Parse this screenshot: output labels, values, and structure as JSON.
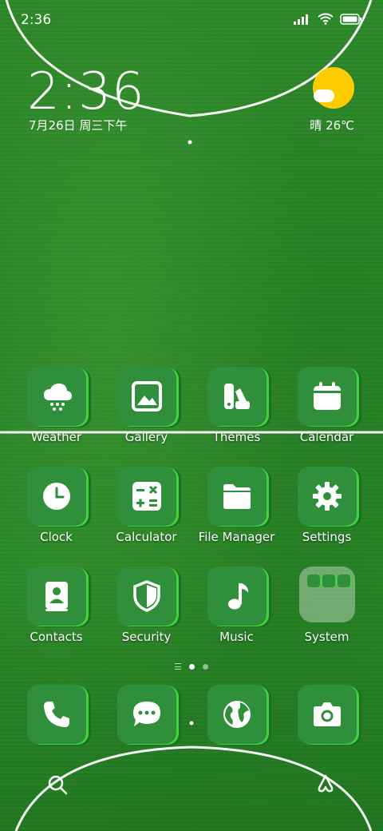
{
  "status_bar": {
    "time": "2:36"
  },
  "lock_clock": {
    "time": "2:36",
    "date": "7月26日 周三下午"
  },
  "weather": {
    "text": "晴 26℃",
    "icon": "sunny-cloud-icon"
  },
  "apps": [
    {
      "label": "Weather",
      "icon": "cloud-snow-icon"
    },
    {
      "label": "Gallery",
      "icon": "image-icon"
    },
    {
      "label": "Themes",
      "icon": "themes-icon"
    },
    {
      "label": "Calendar",
      "icon": "calendar-icon"
    },
    {
      "label": "Clock",
      "icon": "clock-icon"
    },
    {
      "label": "Calculator",
      "icon": "calculator-icon"
    },
    {
      "label": "File Manager",
      "icon": "folder-icon"
    },
    {
      "label": "Settings",
      "icon": "gear-icon"
    },
    {
      "label": "Contacts",
      "icon": "contacts-icon"
    },
    {
      "label": "Security",
      "icon": "shield-icon"
    },
    {
      "label": "Music",
      "icon": "music-note-icon"
    },
    {
      "label": "System",
      "icon": "folder-group-icon"
    }
  ],
  "dock": [
    {
      "icon": "phone-icon"
    },
    {
      "icon": "chat-icon"
    },
    {
      "icon": "globe-icon"
    },
    {
      "icon": "camera-icon"
    }
  ],
  "colors": {
    "tile": "#2f8f3a",
    "tile_edge": "#3fd43f",
    "sun": "#ffcc00"
  },
  "page_indicator": {
    "current": 1,
    "count": 2
  }
}
